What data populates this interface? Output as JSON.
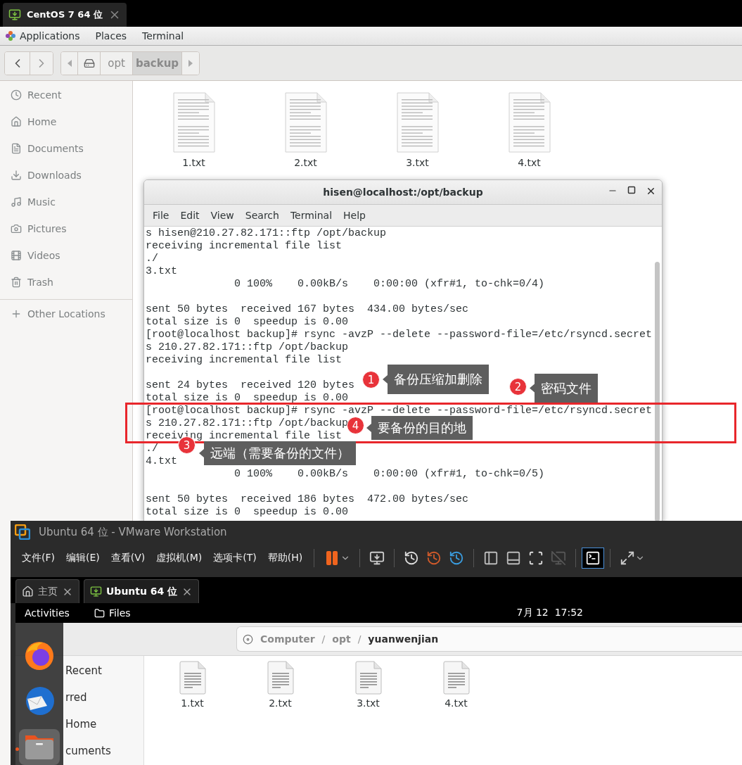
{
  "vm_tab": {
    "title": "CentOS 7 64 位"
  },
  "top_bar": {
    "menus": [
      "Applications",
      "Places",
      "Terminal"
    ]
  },
  "path_bar": {
    "segments": [
      {
        "label": "opt",
        "selected": false
      },
      {
        "label": "backup",
        "selected": true
      }
    ]
  },
  "sidebar": {
    "items": [
      {
        "kind": "recent",
        "label": "Recent"
      },
      {
        "kind": "home",
        "label": "Home"
      },
      {
        "kind": "documents",
        "label": "Documents"
      },
      {
        "kind": "downloads",
        "label": "Downloads"
      },
      {
        "kind": "music",
        "label": "Music"
      },
      {
        "kind": "pictures",
        "label": "Pictures"
      },
      {
        "kind": "videos",
        "label": "Videos"
      },
      {
        "kind": "trash",
        "label": "Trash"
      }
    ],
    "other_locations": "Other Locations"
  },
  "files": [
    "1.txt",
    "2.txt",
    "3.txt",
    "4.txt"
  ],
  "terminal": {
    "title": "hisen@localhost:/opt/backup",
    "menus": [
      "File",
      "Edit",
      "View",
      "Search",
      "Terminal",
      "Help"
    ],
    "blocks": [
      [
        "s hisen@210.27.82.171::ftp /opt/backup",
        "receiving incremental file list",
        "./",
        "3.txt",
        "              0 100%    0.00kB/s    0:00:00 (xfr#1, to-chk=0/4)"
      ],
      [
        "sent 50 bytes  received 167 bytes  434.00 bytes/sec",
        "total size is 0  speedup is 0.00",
        "[root@localhost backup]# rsync -avzP --delete --password-file=/etc/rsyncd.secret",
        "s 210.27.82.171::ftp /opt/backup",
        "receiving incremental file list"
      ],
      [
        "sent 24 bytes  received 120 bytes",
        "total size is 0  speedup is 0.00",
        "[root@localhost backup]# rsync -avzP --delete --password-file=/etc/rsyncd.secret",
        "s 210.27.82.171::ftp /opt/backup",
        "receiving incremental file list",
        "./",
        "4.txt",
        "              0 100%    0.00kB/s    0:00:00 (xfr#1, to-chk=0/5)"
      ],
      [
        "sent 50 bytes  received 186 bytes  472.00 bytes/sec",
        "total size is 0  speedup is 0.00"
      ]
    ]
  },
  "annotations": [
    {
      "number": "1",
      "text": "备份压缩加删除"
    },
    {
      "number": "2",
      "text": "密码文件"
    },
    {
      "number": "3",
      "text": "远端（需要备份的文件）"
    },
    {
      "number": "4",
      "text": "要备份的目的地"
    }
  ],
  "vmware": {
    "title": "Ubuntu 64 位 - VMware Workstation",
    "menus": [
      "文件(F)",
      "编辑(E)",
      "查看(V)",
      "虚拟机(M)",
      "选项卡(T)",
      "帮助(H)"
    ],
    "tabs": [
      {
        "kind": "home",
        "label": "主页",
        "selected": false
      },
      {
        "kind": "vm",
        "label": "Ubuntu 64 位",
        "selected": true
      }
    ],
    "ubuntu_bar": {
      "activities": "Activities",
      "app": "Files",
      "clock": "7月 12  17:52"
    },
    "path": [
      "Computer",
      "opt",
      "yuanwenjian"
    ],
    "path_separators": [
      "/",
      "/"
    ],
    "sidebar": [
      "Recent",
      "rred",
      "Home",
      "cuments"
    ],
    "files": [
      "1.txt",
      "2.txt",
      "3.txt",
      "4.txt"
    ]
  }
}
